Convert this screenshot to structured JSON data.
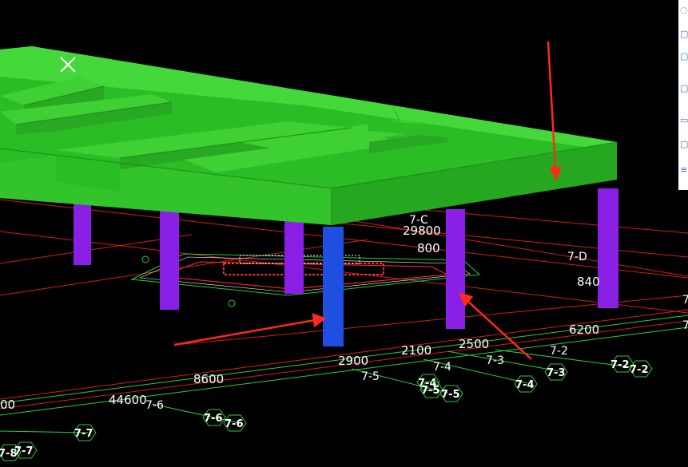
{
  "viewport": {
    "dimensions": [
      "29800",
      "800",
      "840",
      "6200",
      "2900",
      "2100",
      "2500",
      "8600",
      "44600",
      "00"
    ],
    "grid_labels": [
      "7-C",
      "7-D",
      "7-2",
      "7-3",
      "7-4",
      "7-5",
      "7-6"
    ],
    "axis_bubbles": [
      "7-2",
      "7-2",
      "7-3",
      "7-4",
      "7-4",
      "7-5",
      "7-5",
      "7-6",
      "7-6",
      "7-7",
      "7-8",
      "7-7"
    ],
    "edge_marks": [
      "7",
      "7"
    ]
  },
  "colors": {
    "background": "#000000",
    "beam": "#33cc2a",
    "column": "#8a1fe6",
    "highlight_column": "#1f4fe0",
    "grid_red": "#e0201a",
    "grid_green": "#2ecc3a",
    "arrow": "#ff2a1a"
  },
  "icons": {
    "close": "close-icon",
    "toolbar": [
      "orbit-icon",
      "zoom-icon",
      "box-icon",
      "view-cube-icon",
      "layer-icon",
      "settings-icon",
      "list-icon"
    ]
  }
}
